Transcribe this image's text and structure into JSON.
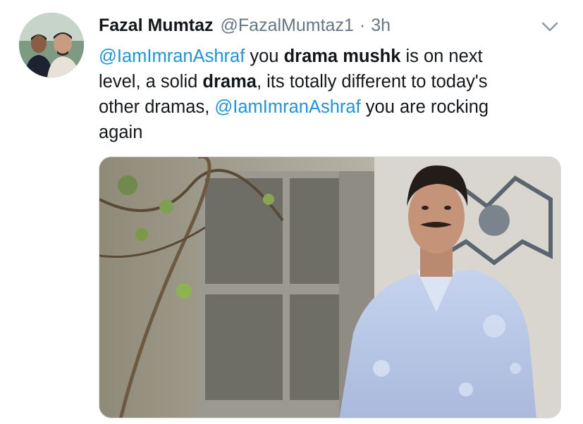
{
  "tweet": {
    "author_name": "Fazal Mumtaz",
    "author_handle": "@FazalMumtaz1",
    "separator": "·",
    "time": "3h",
    "avatar_icon": "avatar-photo",
    "menu_icon": "chevron-down-icon",
    "body_lines": [
      [
        {
          "text": "@IamImranAshraf",
          "style": "mention"
        },
        {
          "text": " you ",
          "style": "normal"
        },
        {
          "text": "drama mushk",
          "style": "bold"
        },
        {
          "text": " is on next",
          "style": "normal"
        }
      ],
      [
        {
          "text": "level, a solid ",
          "style": "normal"
        },
        {
          "text": "drama",
          "style": "bold"
        },
        {
          "text": ", its totally different to today's",
          "style": "normal"
        }
      ],
      [
        {
          "text": "other dramas, ",
          "style": "normal"
        },
        {
          "text": "@IamImranAshraf",
          "style": "mention"
        },
        {
          "text": " you are rocking",
          "style": "normal"
        }
      ],
      [
        {
          "text": "again",
          "style": "normal"
        }
      ]
    ],
    "media_description_icon": "photo-still"
  },
  "colors": {
    "mention": "#1b95e0",
    "secondary_text": "#657786",
    "primary_text": "#14171a"
  }
}
